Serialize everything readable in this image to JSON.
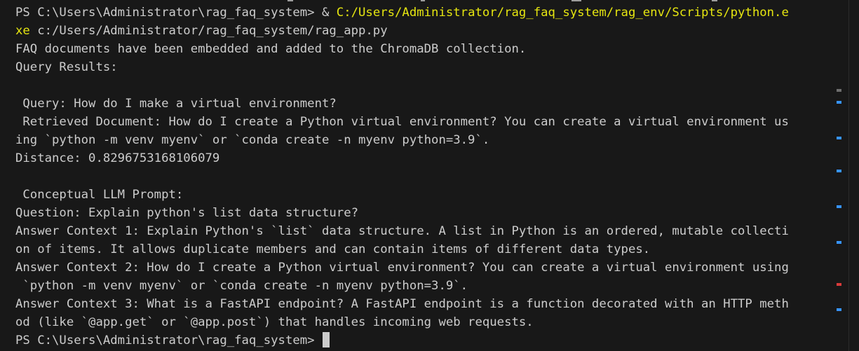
{
  "terminal": {
    "prompt_line_1": {
      "prompt": "PS C:\\Users\\Administrator\\rag_faq_system> & ",
      "exe_path_part1": "C:/Users/Administrator/rag_faq_system/rag_env/Scripts/python.e"
    },
    "prompt_line_2": {
      "exe_path_part2": "xe",
      "script_arg": " c:/Users/Administrator/rag_faq_system/rag_app.py"
    },
    "output": [
      "FAQ documents have been embedded and added to the ChromaDB collection.",
      "Query Results:",
      "",
      " Query: How do I make a virtual environment?",
      " Retrieved Document: How do I create a Python virtual environment? You can create a virtual environment us",
      "ing `python -m venv myenv` or `conda create -n myenv python=3.9`.",
      "Distance: 0.8296753168106079",
      "",
      " Conceptual LLM Prompt:",
      "Question: Explain python's list data structure?",
      "Answer Context 1: Explain Python's `list` data structure. A list in Python is an ordered, mutable collecti",
      "on of items. It allows duplicate members and can contain items of different data types.",
      "Answer Context 2: How do I create a Python virtual environment? You can create a virtual environment using",
      " `python -m venv myenv` or `conda create -n myenv python=3.9`.",
      "Answer Context 3: What is a FastAPI endpoint? A FastAPI endpoint is a function decorated with an HTTP meth",
      "od (like `@app.get` or `@app.post`) that handles incoming web requests."
    ],
    "final_prompt": "PS C:\\Users\\Administrator\\rag_faq_system> ",
    "colors": {
      "background": "#181818",
      "foreground": "#cccccc",
      "highlight_yellow": "#e5e510",
      "decoration_success": "#3794ff",
      "decoration_default": "#8a8a8a"
    }
  }
}
